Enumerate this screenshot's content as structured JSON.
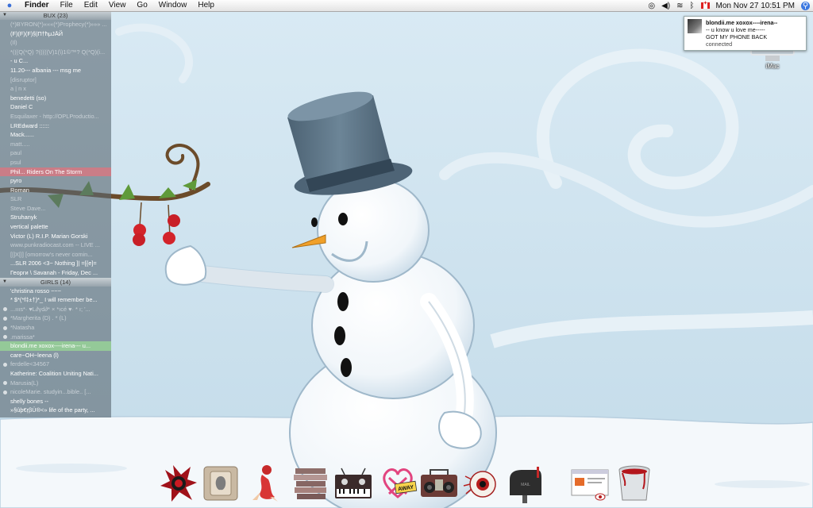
{
  "menubar": {
    "apple_icon": "apple-icon",
    "app_name": "Finder",
    "menus": [
      "File",
      "Edit",
      "View",
      "Go",
      "Window",
      "Help"
    ],
    "status_icons": [
      "mirror-icon",
      "volume-icon",
      "wifi-icon",
      "bluetooth-icon",
      "canada-flag-icon"
    ],
    "clock": "Mon  Nov 27  10:51 PM",
    "spotlight_icon": "spotlight-search-icon"
  },
  "buddy_list": {
    "group1": {
      "title": "BUX (23)",
      "buddies": [
        {
          "name": "(*)BYRON(*)«««(*)Prophecy(*)»»» ...",
          "state": "idle"
        },
        {
          "name": "(F)(F)(F)§|Π†ħμJĀЙ",
          "state": "online"
        },
        {
          "name": "(Il)",
          "state": "idle"
        },
        {
          "name": "*(((Q(*Q) ?(((((V)1(\\)1©™? Q(*Q)(i...",
          "state": "idle"
        },
        {
          "name": "-                                          u C...",
          "state": "online"
        },
        {
          "name": "11.20--- albania --- msg me",
          "state": "online"
        },
        {
          "name": "[disruptor]",
          "state": "idle"
        },
        {
          "name": "a | n x",
          "state": "idle"
        },
        {
          "name": "benedetti (so)",
          "state": "online"
        },
        {
          "name": "Daniel C",
          "state": "online"
        },
        {
          "name": "Esquilaxer - http://OPLProductio...",
          "state": "idle"
        },
        {
          "name": "LREdward ::::::",
          "state": "online"
        },
        {
          "name": "Mack......",
          "state": "online"
        },
        {
          "name": "matt.....",
          "state": "idle"
        },
        {
          "name": "paul",
          "state": "idle"
        },
        {
          "name": "psul",
          "state": "idle"
        },
        {
          "name": "Phil... Riders On The Storm",
          "state": "selected-red"
        },
        {
          "name": "pyro",
          "state": "online"
        },
        {
          "name": "Roman",
          "state": "online"
        },
        {
          "name": "SLR",
          "state": "idle"
        },
        {
          "name": "Steve Dave...",
          "state": "idle"
        },
        {
          "name": "Struhanyk",
          "state": "online"
        },
        {
          "name": "vertical palette",
          "state": "online"
        },
        {
          "name": "Victor   (L)   R.I.P. Marian Gorski",
          "state": "online"
        },
        {
          "name": "www.punkradiocast.com -- LIVE ...",
          "state": "idle"
        },
        {
          "name": "[|]X[|]    [omorrow's never comin...",
          "state": "idle"
        },
        {
          "name": "...SLR 2006 <3~ Nothing  ]| =[{e]=",
          "state": "online"
        },
        {
          "name": "Георги \\ Savanah - Friday, Dec ...",
          "state": "online"
        }
      ]
    },
    "group2": {
      "title": "GIRLS (14)",
      "buddies": [
        {
          "name": "'christina rosso ~~~",
          "state": "online"
        },
        {
          "name": "* $*(*f‡±†)*_ I will remember be...",
          "state": "online"
        },
        {
          "name": "...ıııs*· ♥L∂γd∂* ×  *ıcé ♥· *  ı; '...",
          "state": "away"
        },
        {
          "name": "*Margherita (D) . *          (L)",
          "state": "away"
        },
        {
          "name": "*Natasha",
          "state": "away"
        },
        {
          "name": ".marissa*",
          "state": "away"
        },
        {
          "name": "blondii.me xoxox----irena--- u...",
          "state": "selected-green"
        },
        {
          "name": "care~OH~leena (l)",
          "state": "online"
        },
        {
          "name": "ferdelle<34567",
          "state": "away"
        },
        {
          "name": "Katherine: Coalition Uniting Nati...",
          "state": "online"
        },
        {
          "name": "Marusia(L)",
          "state": "away"
        },
        {
          "name": "nicoleMarie.      studyin...bible.. [...",
          "state": "away"
        },
        {
          "name": "shelly bones --",
          "state": "online"
        },
        {
          "name": "»§ûþ€ŗβÜ®<» life of the party, ...",
          "state": "online"
        }
      ]
    }
  },
  "notification": {
    "line1": "blondii.me  xoxox----irena--",
    "line2": "-- u know u love me-----",
    "line3": "GOT MY PHONE BACK",
    "status": "connected"
  },
  "desktop_icon": {
    "label": "iMac"
  },
  "dock": {
    "items": [
      "red-splatter-app-icon",
      "apple-light-switch-icon",
      "pinup-girl-icon",
      "stacked-books-icon",
      "synthesizer-icon",
      "heartagram-away-icon",
      "boombox-icon",
      "eyeball-icon",
      "mailbox-icon",
      "browser-window-icon",
      "trash-can-icon"
    ],
    "away_label": "AWAY",
    "mail_label": "MAIL"
  },
  "colors": {
    "sky": "#cfe3ef",
    "snow": "#f4f8fb",
    "hat": "#5e7485",
    "selected_red": "#d67882",
    "selected_green": "#96d296"
  }
}
